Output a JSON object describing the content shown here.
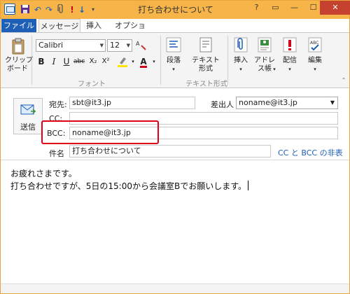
{
  "window": {
    "title": "打ち合わせについて",
    "accent": "#f6b449",
    "close_label": "✕"
  },
  "tabs": {
    "file": "ファイル",
    "message": "メッセージ",
    "insert": "挿入",
    "options": "オプション"
  },
  "ribbon": {
    "clipboard_label": "クリップ\nボード",
    "clipboard_line1": "クリップ",
    "clipboard_line2": "ボード",
    "font_name": "Calibri",
    "font_size": "12",
    "font_group_label": "フォント",
    "paragraph_label": "段落",
    "text_format_line1": "テキスト",
    "text_format_line2": "形式",
    "text_format_group_label": "テキスト形式",
    "insert_label": "挿入",
    "address_book_line1": "アドレ",
    "address_book_line2": "ス帳",
    "delivery_label": "配信",
    "edit_label": "編集"
  },
  "header": {
    "send_label": "送信",
    "to_label": "宛先:",
    "to_value": "sbt@it3.jp",
    "from_label": "差出人",
    "from_value": "noname@it3.jp",
    "cc_label": "CC:",
    "cc_value": "",
    "bcc_label": "BCC:",
    "bcc_value": "noname@it3.jp",
    "subject_label": "件名",
    "subject_value": "打ち合わせについて",
    "hide_cc_bcc": "CC と BCC の非表示",
    "highlight_color": "#e2001a"
  },
  "body": {
    "line1": "お疲れさまです。",
    "line2": "打ち合わせですが、5日の15:00から会議室Bでお願いします。"
  }
}
